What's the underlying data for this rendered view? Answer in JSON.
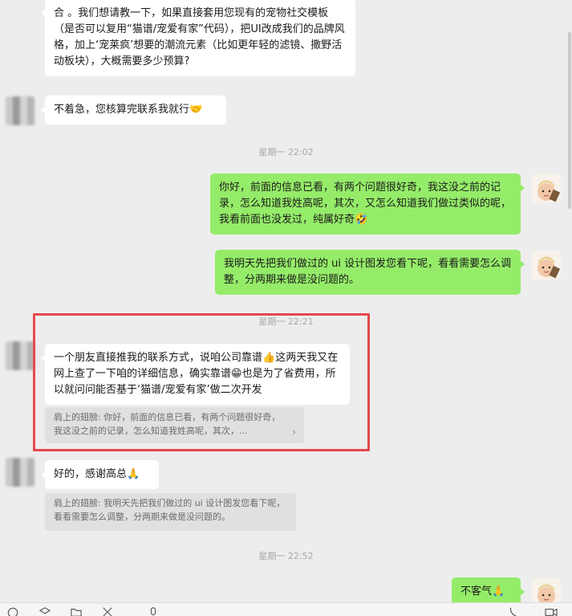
{
  "messages": [
    {
      "side": "in",
      "text": "合 。我们想请教一下，如果直接套用您现有的宠物社交模板（是否可以复用“猫谱/宠爱有家”代码），把UI改成我们的品牌风格，加上‘宠莱疯’想要的潮流元素（比如更年轻的滤镜、撒野活动板块），大概需要多少预算?"
    },
    {
      "side": "in",
      "text": "不着急，您核算完联系我就行",
      "emoji": "🤝"
    },
    {
      "side": "out",
      "text": "你好，前面的信息已看，有两个问题很好奇，我这没之前的记录，怎么知道我姓高呢，其次，又怎么知道我们做过类似的呢，我看前面也没发过，纯属好奇",
      "emoji": "🤣"
    },
    {
      "side": "out",
      "text": "我明天先把我们做过的 ui 设计图发您看下呢，看看需要怎么调整，分两期来做是没问题的。"
    },
    {
      "side": "in",
      "text_a": "一个朋友直接推我的联系方式，说咱公司靠谱",
      "emoji_a": "👍",
      "text_b": "这两天我又在网上查了一下咱的详细信息，确实靠谱",
      "emoji_b": "😁",
      "text_c": "也是为了省费用，所以就问问能否基于‘猫谱/宠爱有家’做二次开发"
    },
    {
      "side": "in",
      "text": "好的，感谢高总",
      "emoji": "🙏"
    },
    {
      "side": "out",
      "text": "不客气",
      "emoji": "🙏"
    }
  ],
  "times": [
    "星期一 22:02",
    "星期一 22:21",
    "星期一 22:52"
  ],
  "quotes": [
    {
      "text": "肩上的翅膀: 你好，前面的信息已看，有两个问题很好奇，我这没之前的记录，怎么知道我姓高呢，其次，...",
      "chevron": "›"
    },
    {
      "text": "肩上的翅膀: 我明天先把我们做过的 ui 设计图发您看下呢，看看需要怎么调整，分两期来做是没问题的。"
    }
  ],
  "colors": {
    "outgoing": "#95ec69",
    "incoming": "#ffffff",
    "background": "#ededed",
    "highlight": "#e5484d"
  },
  "toolbar_icons": [
    "emoji-icon",
    "favorites-icon",
    "folder-icon",
    "screenshot-icon",
    "mic-icon",
    "call-icon",
    "video-icon"
  ]
}
